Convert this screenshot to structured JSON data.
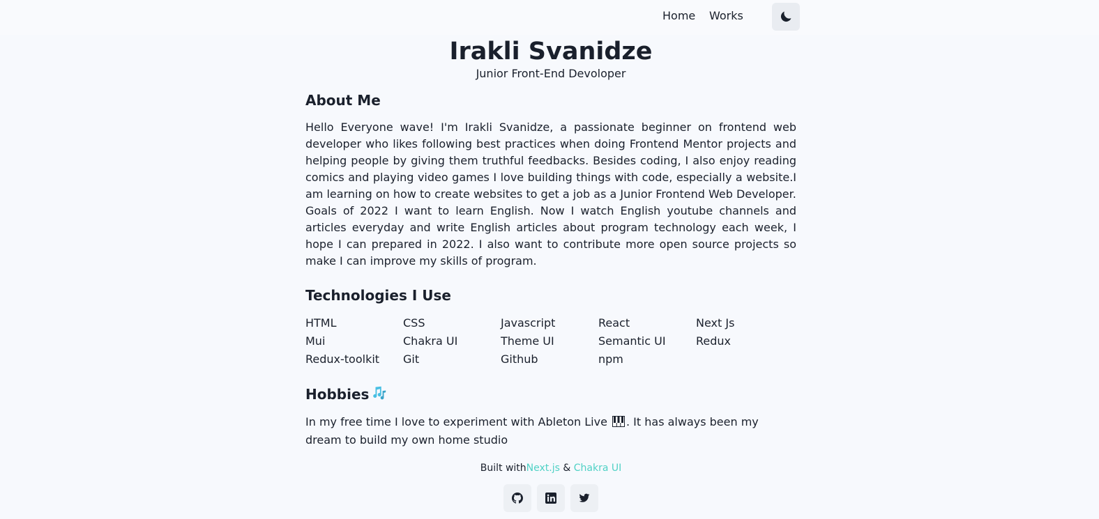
{
  "nav": {
    "links": [
      {
        "label": "Home"
      },
      {
        "label": "Works"
      }
    ],
    "theme_toggle_icon": "moon-icon"
  },
  "header": {
    "name": "Irakli Svanidze",
    "subtitle": "Junior Front-End Devoloper"
  },
  "about": {
    "heading": "About Me",
    "paragraph1": "Hello Everyone wave! I'm Irakli Svanidze, a passionate beginner on frontend web developer who likes following best practices when doing Frontend Mentor projects and helping people by giving them truthful feedbacks. Besides coding, I also enjoy reading comics and playing video games I love building things with code, especially a website.I am learning on how to create websites to get a job as a Junior Frontend Web Developer.",
    "paragraph2": "Goals of 2022 I want to learn English. Now I watch English youtube channels and articles everyday and write English articles about program technology each week, I hope I can prepared in 2022. I also want to contribute more open source projects so make I can improve my skills of program."
  },
  "technologies": {
    "heading": "Technologies I Use",
    "items": [
      "HTML",
      "CSS",
      "Javascript",
      "React",
      "Next Js",
      "Mui",
      "Chakra UI",
      "Theme UI",
      "Semantic UI",
      "Redux",
      "Redux-toolkit",
      "Git",
      "Github",
      "npm"
    ]
  },
  "hobbies": {
    "heading": "Hobbies",
    "heading_icon": "music-notes-icon",
    "text_before": "In my free time I love to experiment with Ableton Live",
    "text_icon": "piano-keys-icon",
    "text_after": ". It has always been my dream to build my own home studio"
  },
  "footer": {
    "built_with": "Built with",
    "nextjs": "Next.js",
    "amp": "&",
    "chakra": "Chakra UI",
    "accent_color": "#4fd1c5",
    "social": [
      {
        "icon": "github-icon"
      },
      {
        "icon": "linkedin-icon"
      },
      {
        "icon": "twitter-icon"
      }
    ]
  }
}
